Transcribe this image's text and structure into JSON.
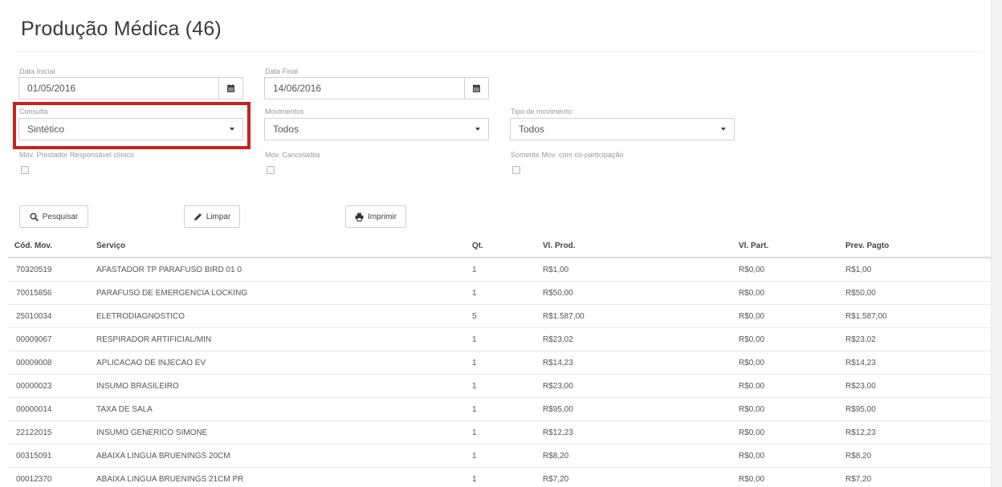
{
  "page": {
    "title": "Produção Médica (46)"
  },
  "filters": {
    "data_inicial": {
      "label": "Data Inicial",
      "value": "01/05/2016"
    },
    "data_final": {
      "label": "Data Final",
      "value": "14/06/2016"
    },
    "consulta": {
      "label": "Consulta",
      "value": "Sintético"
    },
    "movimentos": {
      "label": "Movimentos",
      "value": "Todos"
    },
    "tipo_movimento": {
      "label": "Tipo de movimento",
      "value": "Todos"
    },
    "mov_prestador": {
      "label": "Mov. Prestador Responsável clínico",
      "checked": false
    },
    "mov_cancelados": {
      "label": "Mov. Cancelados",
      "checked": false
    },
    "somente_coparticipacao": {
      "label": "Somente Mov. com co-participação",
      "checked": false
    }
  },
  "actions": {
    "pesquisar": "Pesquisar",
    "limpar": "Limpar",
    "imprimir": "Imprimir"
  },
  "table": {
    "headers": [
      "Cód. Mov.",
      "Serviço",
      "Qt.",
      "Vl. Prod.",
      "Vl. Part.",
      "Prev. Pagto"
    ],
    "rows": [
      [
        "70320519",
        "AFASTADOR TP PARAFUSO BIRD 01 0",
        "1",
        "R$1,00",
        "R$0,00",
        "R$1,00"
      ],
      [
        "70015856",
        "PARAFUSO DE EMERGENCIA LOCKING",
        "1",
        "R$50,00",
        "R$0,00",
        "R$50,00"
      ],
      [
        "25010034",
        "ELETRODIAGNOSTICO",
        "5",
        "R$1.587,00",
        "R$0,00",
        "R$1.587,00"
      ],
      [
        "00009067",
        "RESPIRADOR ARTIFICIAL/MIN",
        "1",
        "R$23,02",
        "R$0,00",
        "R$23,02"
      ],
      [
        "00009008",
        "APLICACAO DE INJECAO EV",
        "1",
        "R$14,23",
        "R$0,00",
        "R$14,23"
      ],
      [
        "00000023",
        "INSUMO BRASILEIRO",
        "1",
        "R$23,00",
        "R$0,00",
        "R$23,00"
      ],
      [
        "00000014",
        "TAXA DE SALA",
        "1",
        "R$95,00",
        "R$0,00",
        "R$95,00"
      ],
      [
        "22122015",
        "INSUMO GENERICO SIMONE",
        "1",
        "R$12,23",
        "R$0,00",
        "R$12,23"
      ],
      [
        "00315091",
        "ABAIXA LINGUA BRUENINGS 20CM",
        "1",
        "R$8,20",
        "R$0,00",
        "R$8,20"
      ],
      [
        "00012370",
        "ABAIXA LINGUA BRUENINGS 21CM PR",
        "1",
        "R$7,20",
        "R$0,00",
        "R$7,20"
      ]
    ]
  },
  "colors": {
    "highlight": "#cc1f1f",
    "text": "#555555",
    "label": "#9a9a9a"
  }
}
